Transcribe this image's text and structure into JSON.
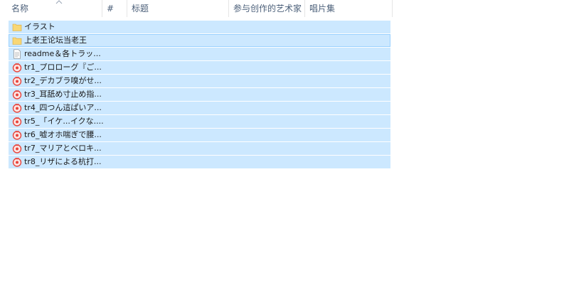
{
  "columns": {
    "name": "名称",
    "number": "#",
    "title": "标题",
    "artist": "参与创作的艺术家",
    "album": "唱片集"
  },
  "files": [
    {
      "name": "イラスト",
      "icon": "folder-icon"
    },
    {
      "name": "上老王论坛当老王",
      "icon": "folder-icon"
    },
    {
      "name": "readme＆各トラッ...",
      "icon": "text-file-icon"
    },
    {
      "name": "tr1_プロローグ『ご...",
      "icon": "media-file-icon"
    },
    {
      "name": "tr2_デカブラ嗅がせ...",
      "icon": "media-file-icon"
    },
    {
      "name": "tr3_耳舐め寸止め指...",
      "icon": "media-file-icon"
    },
    {
      "name": "tr4_四つん這ぱいア...",
      "icon": "media-file-icon"
    },
    {
      "name": "tr5_「イケ...イクな....",
      "icon": "media-file-icon"
    },
    {
      "name": "tr6_嘘オホ喘ぎで腰...",
      "icon": "media-file-icon"
    },
    {
      "name": "tr7_マリアとベロキ...",
      "icon": "media-file-icon"
    },
    {
      "name": "tr8_リザによる杭打...",
      "icon": "media-file-icon"
    }
  ],
  "colors": {
    "selection": "#cce8ff",
    "selection_border": "#99d1ff",
    "header_text": "#4c607a",
    "folder": "#f8d775",
    "media_icon": "#e8453c"
  }
}
